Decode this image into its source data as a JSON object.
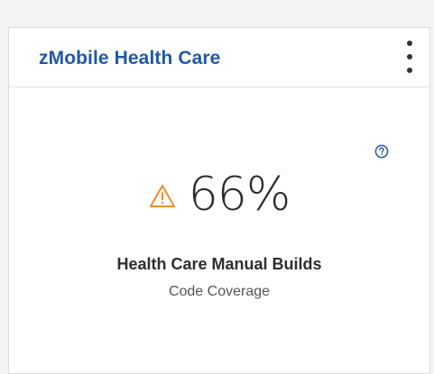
{
  "card": {
    "title": "zMobile Health Care",
    "menu_icon": "overflow-menu-vertical-icon",
    "help_icon": "question-circle-icon",
    "metric": {
      "status_icon": "warning-triangle-icon",
      "status_color": "#f28c28",
      "value": "66%",
      "name": "Health Care Manual Builds",
      "subtitle": "Code Coverage"
    }
  },
  "colors": {
    "title": "#2159a6",
    "help_icon": "#2159a6",
    "warning": "#f28c28"
  }
}
